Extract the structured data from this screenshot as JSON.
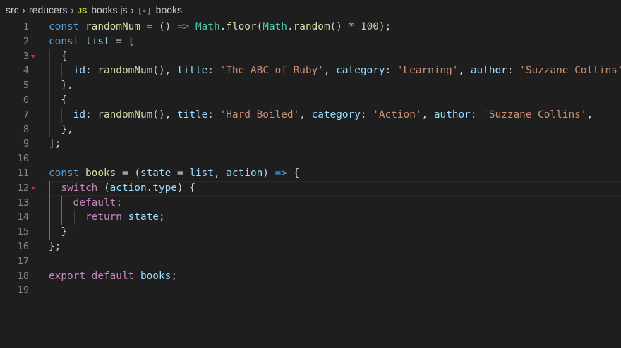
{
  "breadcrumb": {
    "folder1": "src",
    "folder2": "reducers",
    "file_icon": "JS",
    "file": "books.js",
    "symbol_icon": "[∘]",
    "symbol": "books"
  },
  "editor": {
    "language": "javascript",
    "line_numbers": [
      "1",
      "2",
      "3",
      "4",
      "5",
      "6",
      "7",
      "8",
      "9",
      "10",
      "11",
      "12",
      "13",
      "14",
      "15",
      "16",
      "17",
      "18",
      "19"
    ],
    "lines": [
      "const randomNum = () => Math.floor(Math.random() * 100);",
      "const list = [",
      "  {",
      "    id: randomNum(), title: 'The ABC of Ruby', category: 'Learning', author: 'Suzzane Collins',",
      "  },",
      "  {",
      "    id: randomNum(), title: 'Hard Boiled', category: 'Action', author: 'Suzzane Collins',",
      "  },",
      "];",
      "",
      "const books = (state = list, action) => {",
      "  switch (action.type) {",
      "    default:",
      "      return state;",
      "  }",
      "};",
      "",
      "export default books;",
      ""
    ]
  },
  "colors": {
    "background": "#1e1e1e",
    "keyword": "#569cd6",
    "control": "#c586c0",
    "variable": "#9cdcfe",
    "function": "#dcdcaa",
    "string": "#ce9178",
    "number": "#b5cea8"
  }
}
